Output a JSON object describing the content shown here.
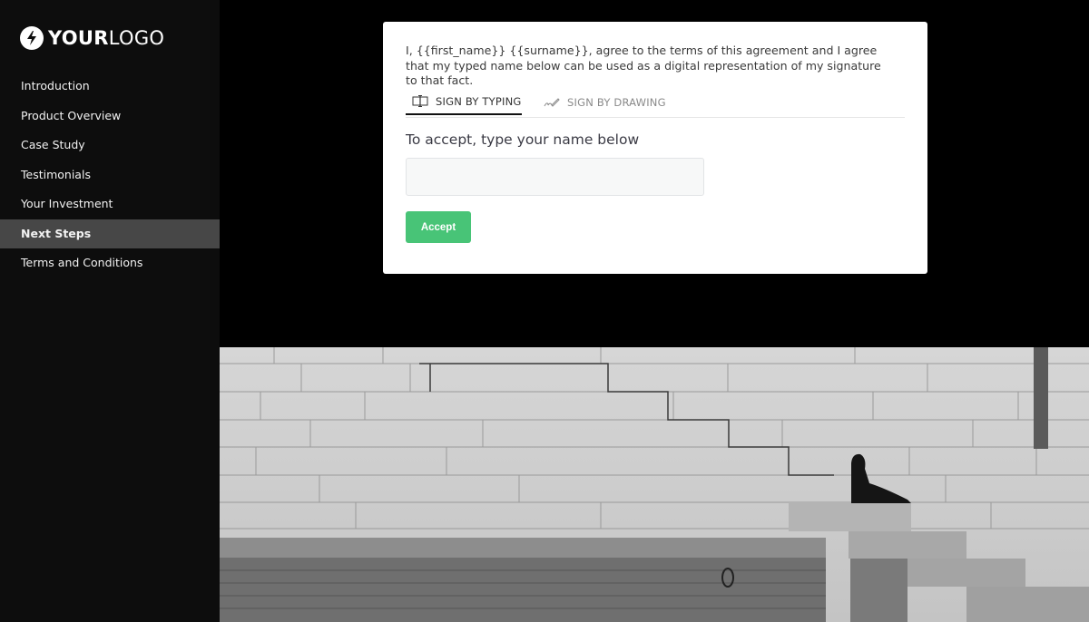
{
  "logo": {
    "bold": "YOUR",
    "light": "LOGO",
    "icon": "lightning-bolt-icon"
  },
  "sidebar": {
    "items": [
      {
        "label": "Introduction",
        "active": false
      },
      {
        "label": "Product Overview",
        "active": false
      },
      {
        "label": "Case Study",
        "active": false
      },
      {
        "label": "Testimonials",
        "active": false
      },
      {
        "label": "Your Investment",
        "active": false
      },
      {
        "label": "Next Steps",
        "active": true
      },
      {
        "label": "Terms and Conditions",
        "active": false
      }
    ]
  },
  "signature": {
    "agreement_text": "I, {{first_name}} {{surname}}, agree to the terms of this agreement and I agree that my typed name below can be used as a digital representation of my signature to that fact.",
    "tabs": [
      {
        "label": "SIGN BY TYPING",
        "icon": "typing-cursor-icon",
        "active": true
      },
      {
        "label": "SIGN BY DRAWING",
        "icon": "pen-signature-icon",
        "active": false
      }
    ],
    "prompt": "To accept, type your name below",
    "name_input": {
      "value": "",
      "placeholder": ""
    },
    "accept_label": "Accept",
    "accent_color": "#48c477"
  },
  "hero_image": {
    "description": "Black and white photo of a person sitting on stone steps beside a large stone wall"
  }
}
